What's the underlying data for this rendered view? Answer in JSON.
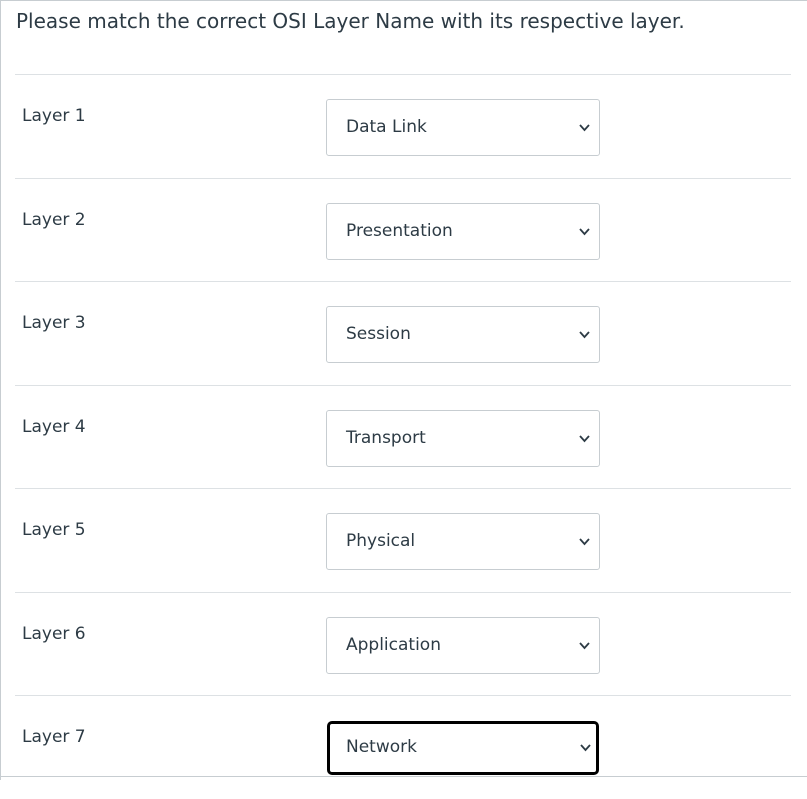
{
  "question": {
    "text": "Please match the correct OSI Layer Name with its respective layer."
  },
  "rows": [
    {
      "label": "Layer 1",
      "selected": "Data Link",
      "focused": false
    },
    {
      "label": "Layer 2",
      "selected": "Presentation",
      "focused": false
    },
    {
      "label": "Layer 3",
      "selected": "Session",
      "focused": false
    },
    {
      "label": "Layer 4",
      "selected": "Transport",
      "focused": false
    },
    {
      "label": "Layer 5",
      "selected": "Physical",
      "focused": false
    },
    {
      "label": "Layer 6",
      "selected": "Application",
      "focused": false
    },
    {
      "label": "Layer 7",
      "selected": "Network",
      "focused": true
    }
  ],
  "icons": {
    "dropdown": "chevron-down-icon"
  },
  "colors": {
    "text": "#2d3b45",
    "border": "#c7cdd1",
    "divider": "#dde1e4",
    "focus_ring": "#000000"
  }
}
